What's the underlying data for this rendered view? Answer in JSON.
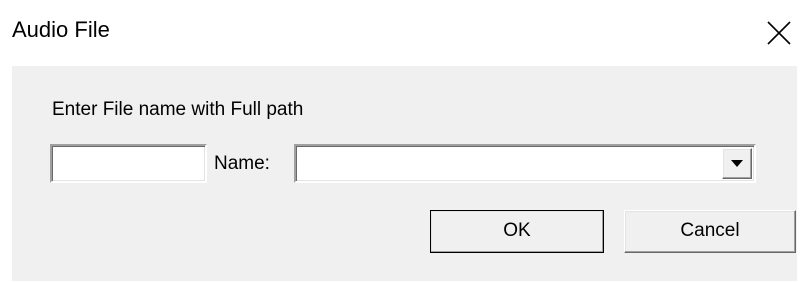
{
  "window": {
    "title": "Audio File",
    "close_icon": "close-icon"
  },
  "form": {
    "prompt": "Enter File name with Full path",
    "path_value": "",
    "name_label": "Name:",
    "name_value": "",
    "dropdown_icon": "chevron-down-icon"
  },
  "buttons": {
    "ok_label": "OK",
    "cancel_label": "Cancel"
  },
  "colors": {
    "client_background": "#f0f0f0",
    "titlebar_background": "#ffffff"
  }
}
